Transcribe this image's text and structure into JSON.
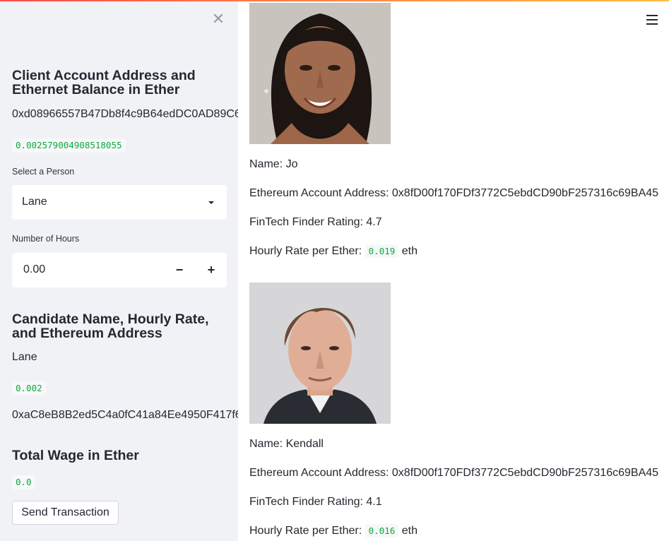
{
  "sidebar": {
    "client_heading": "Client Account Address and Ethernet Balance in Ether",
    "client_address": "0xd08966557B47Db8f4c9B64edDC0AD89C6",
    "client_balance": "0.002579004908518055",
    "select_label": "Select a Person",
    "select_value": "Lane",
    "hours_label": "Number of Hours",
    "hours_value": "0.00",
    "candidate_heading": "Candidate Name, Hourly Rate, and Ethereum Address",
    "candidate_name": "Lane",
    "candidate_rate": "0.002",
    "candidate_address": "0xaC8eB8B2ed5C4a0fC41a84Ee4950F417f6",
    "wage_heading": "Total Wage in Ether",
    "wage_value": "0.0",
    "send_button": "Send Transaction"
  },
  "candidates": [
    {
      "name_line": "Name: Jo",
      "address_line": "Ethereum Account Address: 0x8fD00f170FDf3772C5ebdCD90bF257316c69BA45",
      "rating_line": "FinTech Finder Rating: 4.7",
      "rate_prefix": "Hourly Rate per Ether:",
      "rate_value": "0.019",
      "rate_suffix": "eth"
    },
    {
      "name_line": "Name: Kendall",
      "address_line": "Ethereum Account Address: 0x8fD00f170FDf3772C5ebdCD90bF257316c69BA45",
      "rating_line": "FinTech Finder Rating: 4.1",
      "rate_prefix": "Hourly Rate per Ether:",
      "rate_value": "0.016",
      "rate_suffix": "eth"
    }
  ],
  "icons": {
    "close": "close-icon",
    "menu": "hamburger-menu-icon",
    "minus": "minus-icon",
    "plus": "plus-icon",
    "dropdown": "chevron-down-icon"
  },
  "colors": {
    "accent_code": "#09ab3b",
    "sidebar_bg": "#f0f2f6"
  }
}
